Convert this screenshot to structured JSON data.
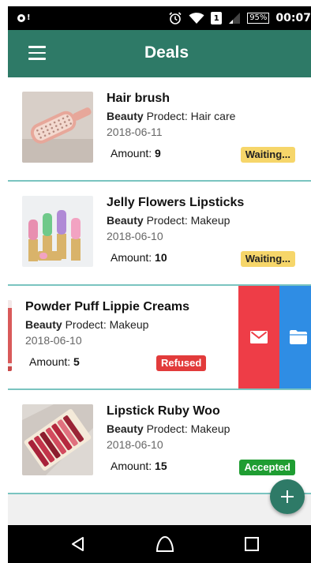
{
  "status_bar": {
    "battery": "95%",
    "sim": "1",
    "time": "00:07"
  },
  "app_bar": {
    "title": "Deals",
    "menu_icon": "hamburger-menu-icon"
  },
  "deals": [
    {
      "title": "Hair brush",
      "category": "Beauty",
      "product_prefix": "Prodect:",
      "product": "Hair care",
      "date": "2018-06-11",
      "amount_label": "Amount:",
      "amount": "9",
      "status": "Waiting..."
    },
    {
      "title": "Jelly Flowers Lipsticks",
      "category": "Beauty",
      "product_prefix": "Prodect:",
      "product": "Makeup",
      "date": "2018-06-10",
      "amount_label": "Amount:",
      "amount": "10",
      "status": "Waiting..."
    },
    {
      "title": "Powder Puff Lippie Creams",
      "category": "Beauty",
      "product_prefix": "Prodect:",
      "product": "Makeup",
      "date": "2018-06-10",
      "amount_label": "Amount:",
      "amount": "5",
      "status": "Refused"
    },
    {
      "title": "Lipstick Ruby Woo",
      "category": "Beauty",
      "product_prefix": "Prodect:",
      "product": "Makeup",
      "date": "2018-06-10",
      "amount_label": "Amount:",
      "amount": "15",
      "status": "Accepted"
    }
  ],
  "swipe_actions": {
    "mail_icon": "envelope-icon",
    "folder_icon": "folder-icon"
  },
  "fab_icon": "plus-icon",
  "colors": {
    "primary": "#2e7a67",
    "waiting": "#f6d66a",
    "refused": "#e23b3b",
    "accepted": "#1f9d32",
    "mail_action": "#ee3d47",
    "folder_action": "#2f8de4",
    "divider": "#7ac4c0"
  }
}
